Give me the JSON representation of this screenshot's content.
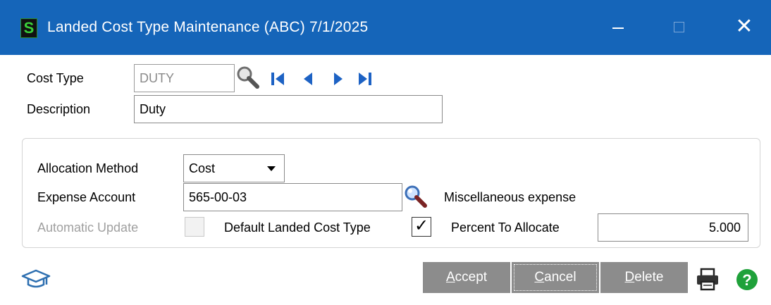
{
  "window": {
    "app_icon_letter": "S",
    "title": "Landed Cost Type Maintenance (ABC) 7/1/2025",
    "close_glyph": "✕"
  },
  "form": {
    "cost_type_label": "Cost Type",
    "cost_type_value": "DUTY",
    "description_label": "Description",
    "description_value": "Duty"
  },
  "details": {
    "allocation_method_label": "Allocation Method",
    "allocation_method_value": "Cost",
    "expense_account_label": "Expense Account",
    "expense_account_value": "565-00-03",
    "expense_account_description": "Miscellaneous expense",
    "automatic_update_label": "Automatic Update",
    "automatic_update_checked": false,
    "default_type_label": "Default Landed Cost Type",
    "default_type_checked": true,
    "percent_label": "Percent To Allocate",
    "percent_value": "5.000"
  },
  "buttons": {
    "accept_underline": "A",
    "accept_rest": "ccept",
    "cancel_underline": "C",
    "cancel_rest": "ancel",
    "delete_underline": "D",
    "delete_rest": "elete"
  },
  "icons": {
    "lookup": "magnifier-icon",
    "first": "first-record-icon",
    "prev": "previous-record-icon",
    "next": "next-record-icon",
    "last": "last-record-icon",
    "account_lookup": "account-lookup-icon",
    "training": "graduation-cap-icon",
    "print": "printer-icon",
    "help": "help-icon"
  },
  "colors": {
    "titlebar": "#1565b9",
    "button": "#8c8c8c",
    "nav_arrows": "#1d62c4",
    "help": "#1fa13a"
  }
}
